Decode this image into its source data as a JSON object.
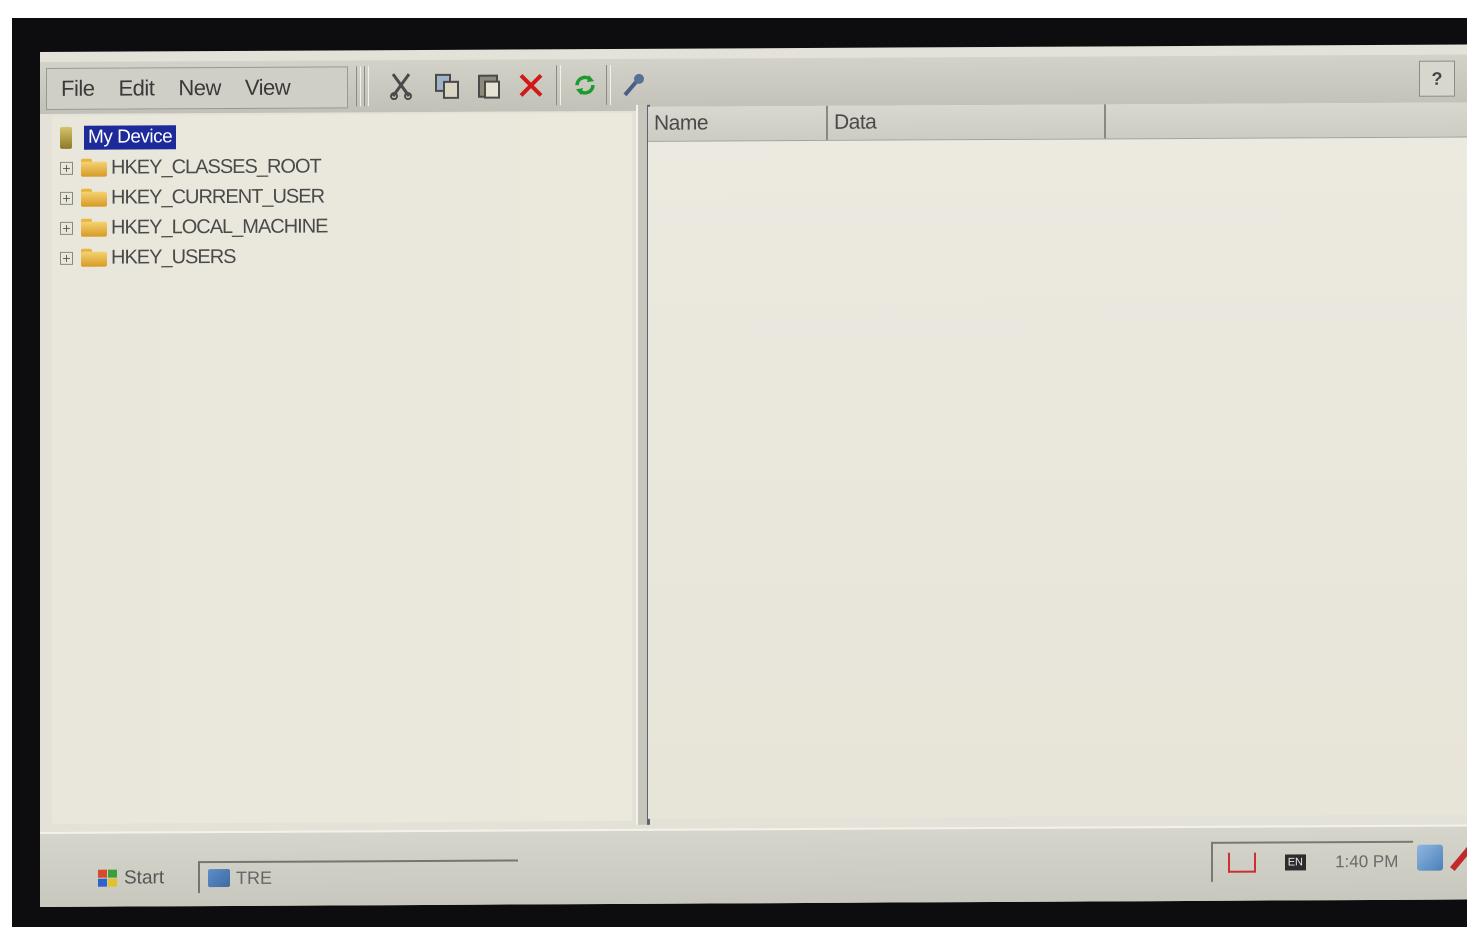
{
  "menu": {
    "items": [
      "File",
      "Edit",
      "New",
      "View"
    ]
  },
  "toolbar": {
    "icons": [
      "cut-icon",
      "copy-icon",
      "paste-icon",
      "delete-icon",
      "refresh-icon",
      "properties-icon"
    ],
    "help_label": "?"
  },
  "tree": {
    "root_label": "My Device",
    "items": [
      {
        "label": "HKEY_CLASSES_ROOT",
        "expander": "+"
      },
      {
        "label": "HKEY_CURRENT_USER",
        "expander": "+"
      },
      {
        "label": "HKEY_LOCAL_MACHINE",
        "expander": "+"
      },
      {
        "label": "HKEY_USERS",
        "expander": "+"
      }
    ]
  },
  "list": {
    "columns": [
      "Name",
      "Data"
    ]
  },
  "taskbar": {
    "start_label": "Start",
    "task_label": "TRE",
    "keyboard_label": "EN",
    "clock": "1:40 PM"
  },
  "colors": {
    "selection": "#1c2a9a",
    "delete_red": "#d01818",
    "refresh_green": "#1d9a2d"
  }
}
